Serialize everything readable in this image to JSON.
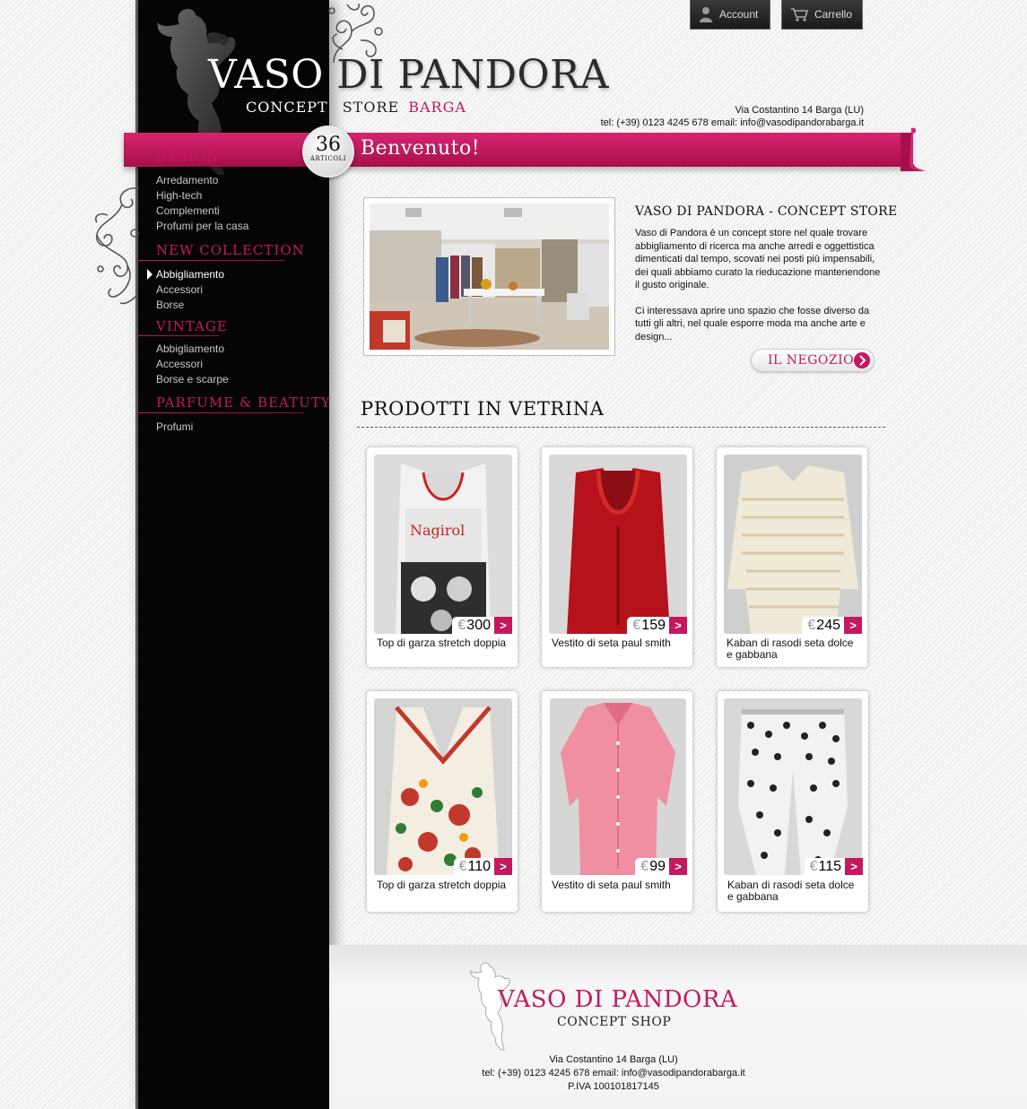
{
  "header": {
    "logo_title_white": "VASO ",
    "logo_title_dark": "DI PANDORA",
    "logo_sub_concept": "CONCEPT",
    "logo_sub_store": "STORE",
    "logo_sub_city": "BARGA",
    "address": "Via Costantino 14 Barga (LU)",
    "contacts": "tel: (+39) 0123 4245 678  email: info@vasodipandorabarga.it",
    "account_label": "Account",
    "cart_label": "Carrello"
  },
  "banner": {
    "count": "36",
    "count_label": "ARTICOLI",
    "title": "Benvenuto!"
  },
  "nav": {
    "sections": [
      {
        "title": "DESIGN",
        "items": [
          "Arredamento",
          "High-tech",
          "Complementi",
          "Profumi per la casa"
        ]
      },
      {
        "title": "NEW COLLECTION",
        "items": [
          "Abbigliamento",
          "Accessori",
          "Borse"
        ]
      },
      {
        "title": "VINTAGE",
        "items": [
          "Abbigliamento",
          "Accessori",
          "Borse e scarpe"
        ]
      },
      {
        "title": "PARFUME & BEATUTY",
        "items": [
          "Profumi"
        ]
      }
    ],
    "active_item": "Abbigliamento"
  },
  "intro": {
    "title": "VASO DI PANDORA - CONCEPT STORE",
    "paragraph1": "Vaso di Pandora è un concept store nel quale trovare abbigliamento di ricerca ma anche arredi e oggettistica dimenticati dal tempo, scovati nei posti più impensabili, dei quali abbiamo curato la rieducazione mantenendone il gusto originale.",
    "paragraph2": "Ci interessava aprire uno spazio che fosse diverso da tutti gli altri, nel quale esporre moda ma anche arte e design...",
    "button_label": "IL NEGOZIO"
  },
  "products": {
    "title": "PRODOTTI IN VETRINA",
    "currency": "€",
    "items": [
      {
        "name": "Top di garza stretch doppia",
        "price": "300"
      },
      {
        "name": "Vestito di seta paul smith",
        "price": "159"
      },
      {
        "name": "Kaban di rasodi seta dolce e gabbana",
        "price": "245"
      },
      {
        "name": "Top di garza stretch doppia",
        "price": "110"
      },
      {
        "name": "Vestito di seta paul smith",
        "price": "99"
      },
      {
        "name": "Kaban di rasodi seta dolce e gabbana",
        "price": "115"
      }
    ],
    "go_label": ">"
  },
  "footer": {
    "logo_title": "VASO DI PANDORA",
    "logo_sub": "CONCEPT SHOP",
    "address": "Via Costantino 14 Barga (LU)",
    "contacts": "tel: (+39) 0123 4245 678  email: info@vasodipandorabarga.it",
    "vat": "P.IVA 100101817145"
  },
  "colors": {
    "accent": "#c5195f",
    "sidebar": "#050505"
  }
}
